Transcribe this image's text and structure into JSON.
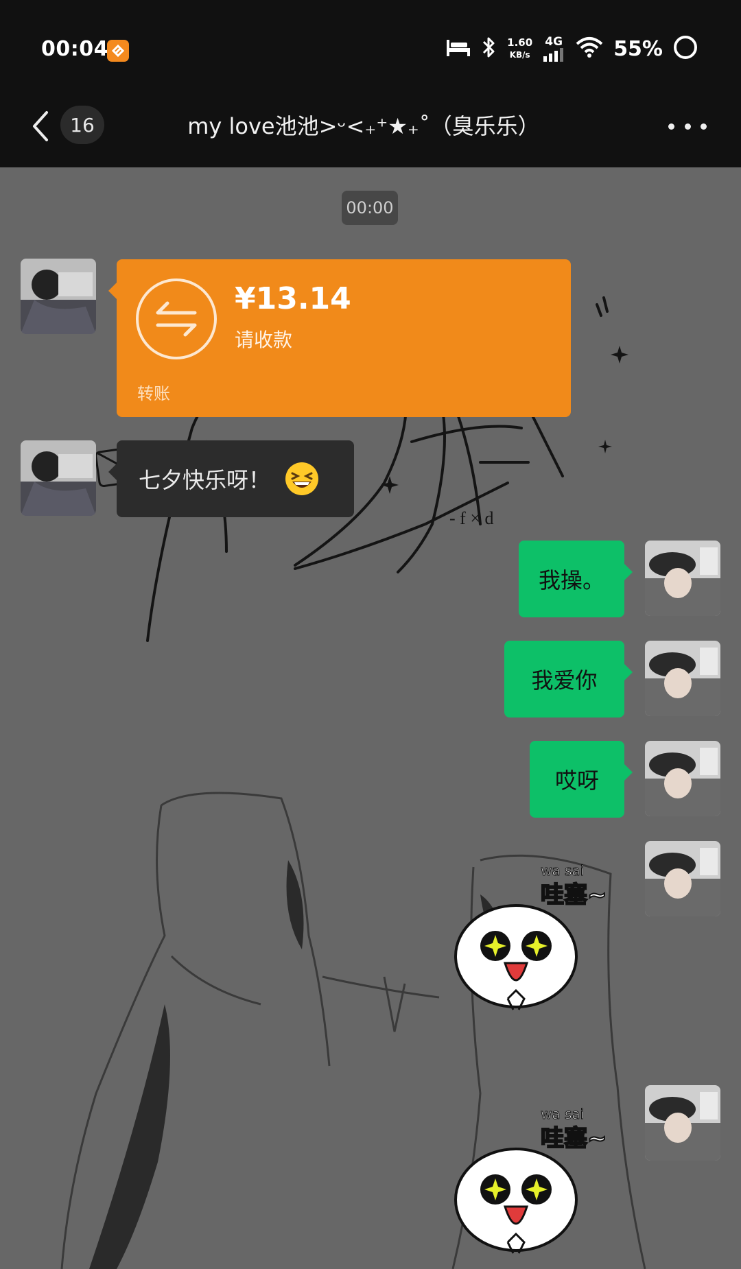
{
  "status_bar": {
    "time": "00:04",
    "speed_value": "1.60",
    "speed_unit": "KB/s",
    "network": "4G",
    "battery": "55%"
  },
  "title_bar": {
    "unread_count": "16",
    "title": "my  love池池>ᵕ<₊⁺★₊˚（臭乐乐）"
  },
  "chat": {
    "timestamp": "00:00",
    "messages": [
      {
        "side": "left",
        "type": "transfer",
        "amount": "¥13.14",
        "status": "请收款",
        "footer": "转账"
      },
      {
        "side": "left",
        "type": "text",
        "text": "七夕快乐呀！",
        "emoji": "grinning-squinting-face"
      },
      {
        "side": "right",
        "type": "text",
        "text": "我操。"
      },
      {
        "side": "right",
        "type": "text",
        "text": "我爱你"
      },
      {
        "side": "right",
        "type": "text",
        "text": "哎呀"
      },
      {
        "side": "right",
        "type": "sticker",
        "caption": "哇塞~",
        "caption_romaji": "wa sai"
      },
      {
        "side": "right",
        "type": "sticker",
        "caption": "哇塞~",
        "caption_romaji": "wa sai"
      }
    ]
  },
  "colors": {
    "accent_green": "#0dc068",
    "transfer_orange": "#f18a1a",
    "chat_background": "#676767"
  }
}
